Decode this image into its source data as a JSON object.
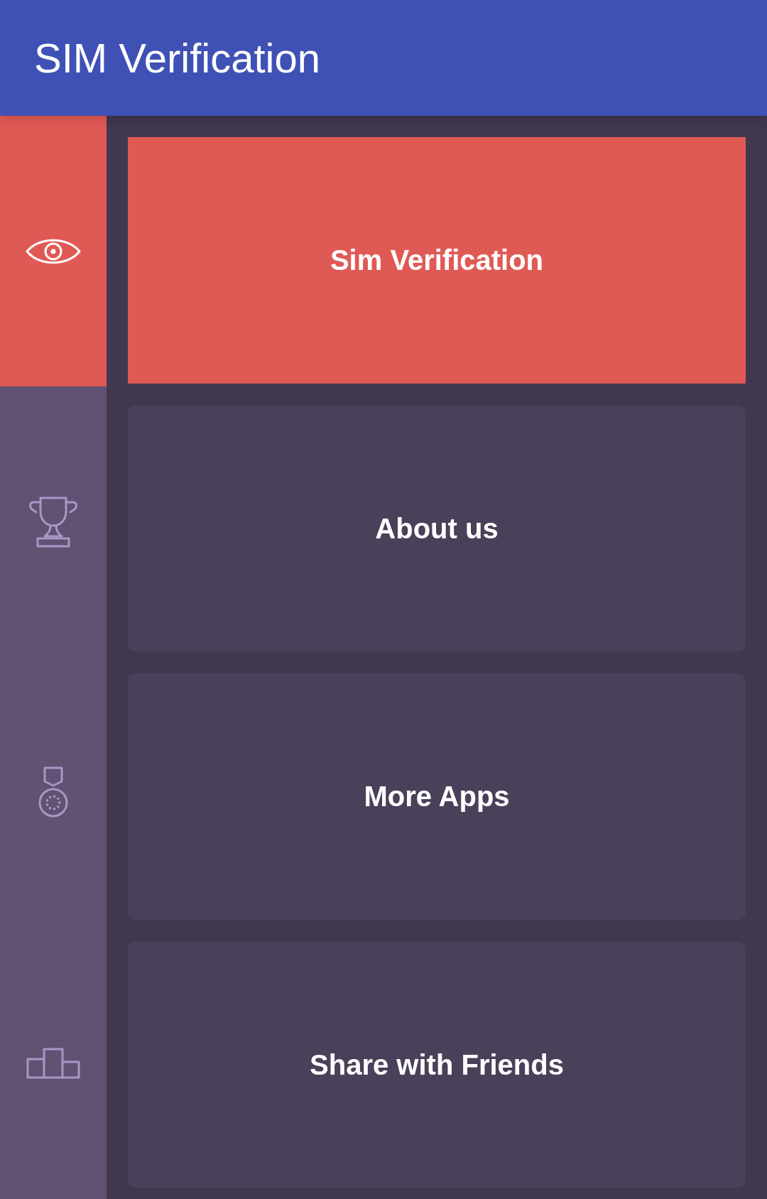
{
  "app_bar": {
    "title": "SIM Verification"
  },
  "sidebar": {
    "items": [
      {
        "kind": "eye",
        "selected": true
      },
      {
        "kind": "trophy",
        "selected": false
      },
      {
        "kind": "medal",
        "selected": false
      },
      {
        "kind": "podium",
        "selected": false
      }
    ]
  },
  "menu": {
    "cards": [
      {
        "label": "Sim Verification",
        "selected": true
      },
      {
        "label": "About us",
        "selected": false
      },
      {
        "label": "More Apps",
        "selected": false
      },
      {
        "label": "Share with Friends",
        "selected": false
      }
    ]
  }
}
